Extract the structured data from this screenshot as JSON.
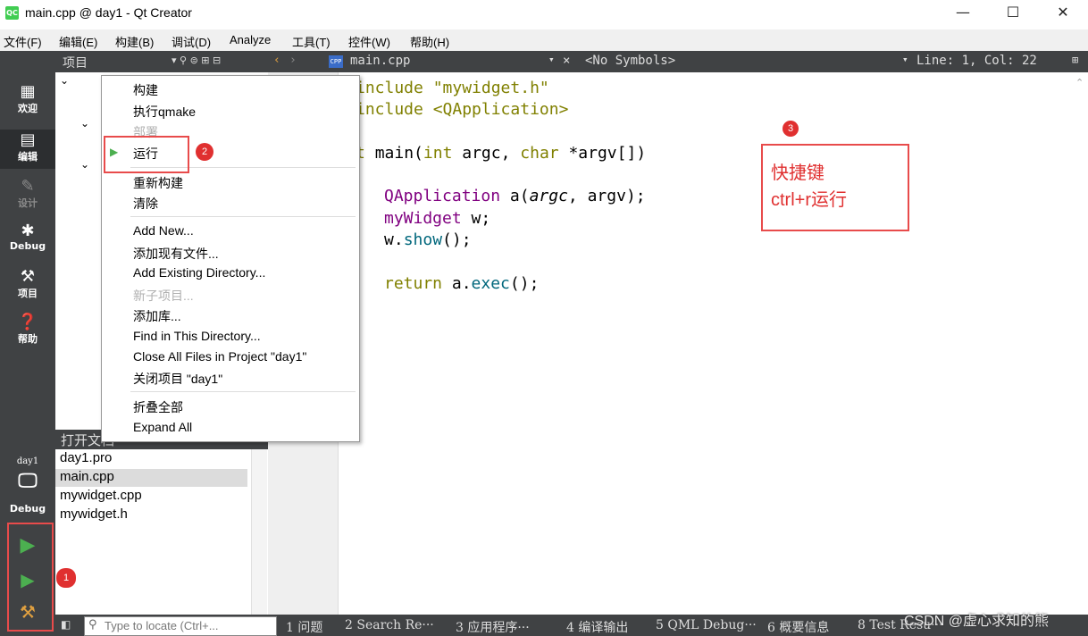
{
  "window": {
    "app_icon_label": "QC",
    "title": "main.cpp @ day1 - Qt Creator",
    "minimize": "—",
    "maximize": "☐",
    "close": "✕"
  },
  "menubar": [
    "文件(F)",
    "编辑(E)",
    "构建(B)",
    "调试(D)",
    "Analyze",
    "工具(T)",
    "控件(W)",
    "帮助(H)"
  ],
  "modes": {
    "welcome": "欢迎",
    "edit": "编辑",
    "design": "设计",
    "debug": "Debug",
    "projects": "项目",
    "help": "帮助"
  },
  "kit": {
    "project": "day1",
    "build": "Debug"
  },
  "project_pane": {
    "title": "项目"
  },
  "open_docs": {
    "title": "打开文档",
    "items": [
      "day1.pro",
      "main.cpp",
      "mywidget.cpp",
      "mywidget.h"
    ],
    "selected": "main.cpp"
  },
  "editor_toolbar": {
    "file": "main.cpp",
    "symbols": "<No Symbols>",
    "position": "Line: 1, Col: 22"
  },
  "code": {
    "line1": "include \"mywidget.h\"",
    "line2": "include <QApplication>",
    "line3_prefix": "t ",
    "line3_main": "main",
    "line3_open": "(",
    "line3_int": "int",
    "line3_argc": " argc, ",
    "line3_char": "char",
    "line3_rest": " *argv[])",
    "line4_type": "QApplication",
    "line4_a": " a(",
    "line4_argc": "argc",
    "line4_rest": ", argv);",
    "line5_type": "myWidget",
    "line5_rest": " w;",
    "line6_obj": "w.",
    "line6_fn": "show",
    "line6_rest": "();",
    "line7_kw": "return",
    "line7_obj": " a.",
    "line7_fn": "exec",
    "line7_rest": "();"
  },
  "context_menu": {
    "build": "构建",
    "qmake": "执行qmake",
    "deploy": "部署",
    "run": "运行",
    "rebuild": "重新构建",
    "clean": "清除",
    "add_new": "Add New...",
    "add_existing_files": "添加现有文件...",
    "add_existing_dir": "Add Existing Directory...",
    "new_subproject": "新子项目...",
    "add_library": "添加库...",
    "find_in_dir": "Find in This Directory...",
    "close_all_files": "Close All Files in Project \"day1\"",
    "close_project": "关闭项目 \"day1\"",
    "collapse_all": "折叠全部",
    "expand_all": "Expand All"
  },
  "annotations": {
    "badge1": "1",
    "badge2": "2",
    "badge3": "3",
    "shortcut_title": "快捷键",
    "shortcut_keys": "ctrl+r运行"
  },
  "bottom": {
    "locate_placeholder": "Type to locate (Ctrl+...",
    "panes": [
      "1 问题",
      "2 Search Re···",
      "3 应用程序···",
      "4 编译输出",
      "5 QML Debug···",
      "6 概要信息",
      "8 Test Resu···"
    ]
  },
  "watermark": "CSDN @虚心求知的熊",
  "colors": {
    "dark_panel": "#404244",
    "annotation_red": "#e84b4b",
    "run_green": "#4caf50"
  }
}
